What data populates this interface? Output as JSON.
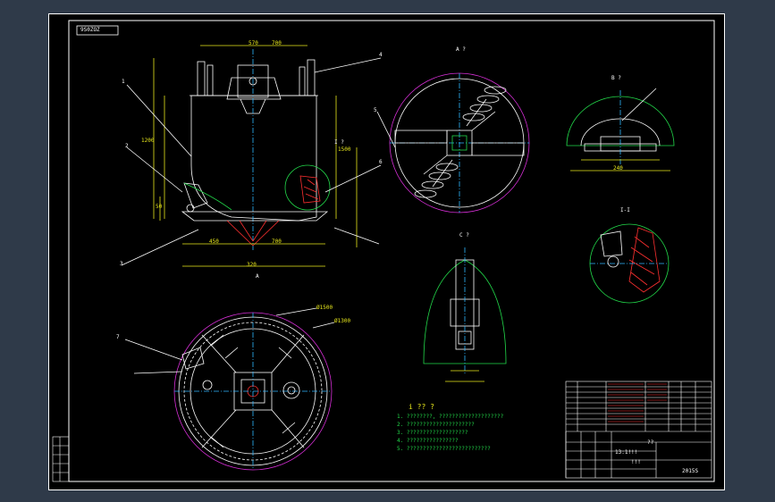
{
  "drawing": {
    "drawing_number": "9S0ZOZ",
    "part_number_tag": "2015S",
    "scale": "13:1!!!",
    "title_block_marks": [
      "??",
      "!!!"
    ],
    "view_labels": [
      "A ?",
      "B ?",
      "C ?",
      "I ?",
      "I-I",
      "A"
    ],
    "callout_numbers": [
      "1",
      "2",
      "3",
      "4",
      "5",
      "6",
      "7"
    ],
    "dimensions": [
      "570",
      "700",
      "1200",
      "1500",
      "450",
      "700",
      "320",
      "50",
      "240",
      "Ø1500",
      "Ø1300"
    ],
    "notes_heading": "i ?? ?",
    "notes_lines": [
      "1. ????????, ????????????????????",
      "2. ?????????????????????",
      "3. ???????????????????",
      "4. ????????????????",
      "5. ??????????????????????????"
    ]
  },
  "colors": {
    "background": "#000000",
    "frame": "#ffffff",
    "outline": "#ffffff",
    "dimension": "#e8e81c",
    "hatch": "#ff3030",
    "center_line": "#2fb7ff",
    "detail_circle": "#22d94a",
    "outer_ring": "#d82fd8"
  }
}
